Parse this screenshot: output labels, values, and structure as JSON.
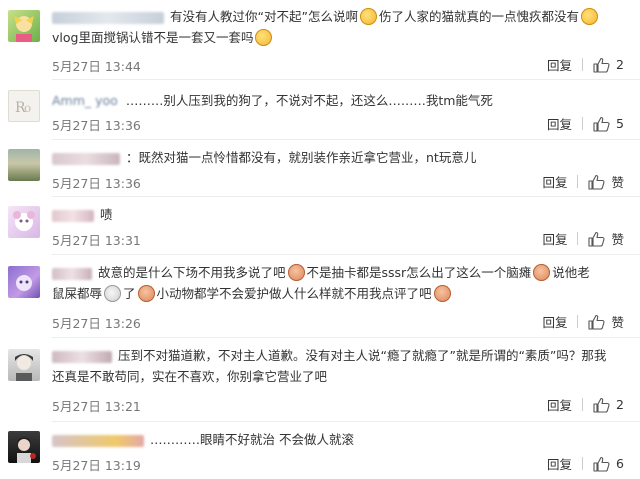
{
  "comments": [
    {
      "name": "d……",
      "text_lines": [
        "有没有人教过你“对不起”怎么说啊",
        "伤了人家的猫就真的一点愧疚都没有",
        "vlog里面搅锅认错不是一套又一套吗"
      ],
      "time": "5月27日 13:44",
      "reply": "回复",
      "likes": "2"
    },
    {
      "name": "Amm_ yoo",
      "text_lines": [
        "………别人压到我的狗了，不说对不起，还这么………我tm能气死"
      ],
      "time": "5月27日 13:36",
      "reply": "回复",
      "likes": "5"
    },
    {
      "name": "",
      "text_lines": [
        "：既然对猫一点怜惜都没有，就别装作亲近拿它营业，nt玩意儿"
      ],
      "time": "5月27日 13:36",
      "reply": "回复",
      "likes": "赞"
    },
    {
      "name": "",
      "text_lines": [
        "啧"
      ],
      "time": "5月27日 13:31",
      "reply": "回复",
      "likes": "赞"
    },
    {
      "name": "",
      "text_lines": [
        "故意的是什么下场不用我多说了吧",
        "不是抽卡都是sssr怎么出了这么一个脑瘫",
        "说他老",
        "鼠屎都辱",
        "了",
        "小动物都学不会爱护做人什么样就不用我点评了吧"
      ],
      "time": "5月27日 13:26",
      "reply": "回复",
      "likes": "赞"
    },
    {
      "name": "",
      "text_lines": [
        "压到不对猫道歉，不对主人道歉。没有对主人说“瘾了就瘾了”就是所谓的“素质”吗？那我",
        "还真是不敢苟同，实在不喜欢，你别拿它营业了吧"
      ],
      "time": "5月27日 13:21",
      "reply": "回复",
      "likes": "2"
    },
    {
      "name": "",
      "text_lines": [
        "…………眼睛不好就治 不会做人就滚"
      ],
      "time": "5月27日 13:19",
      "reply": "回复",
      "likes": "6"
    }
  ],
  "icons": {
    "like": "thumbs-up-icon",
    "emoji_laugh": "laugh-emoji-icon",
    "emoji_pig": "pig-emoji-icon",
    "emoji_mouse": "mouse-emoji-icon"
  },
  "colors": {
    "text": "#333333",
    "meta": "#777777",
    "divider": "#ededed"
  }
}
